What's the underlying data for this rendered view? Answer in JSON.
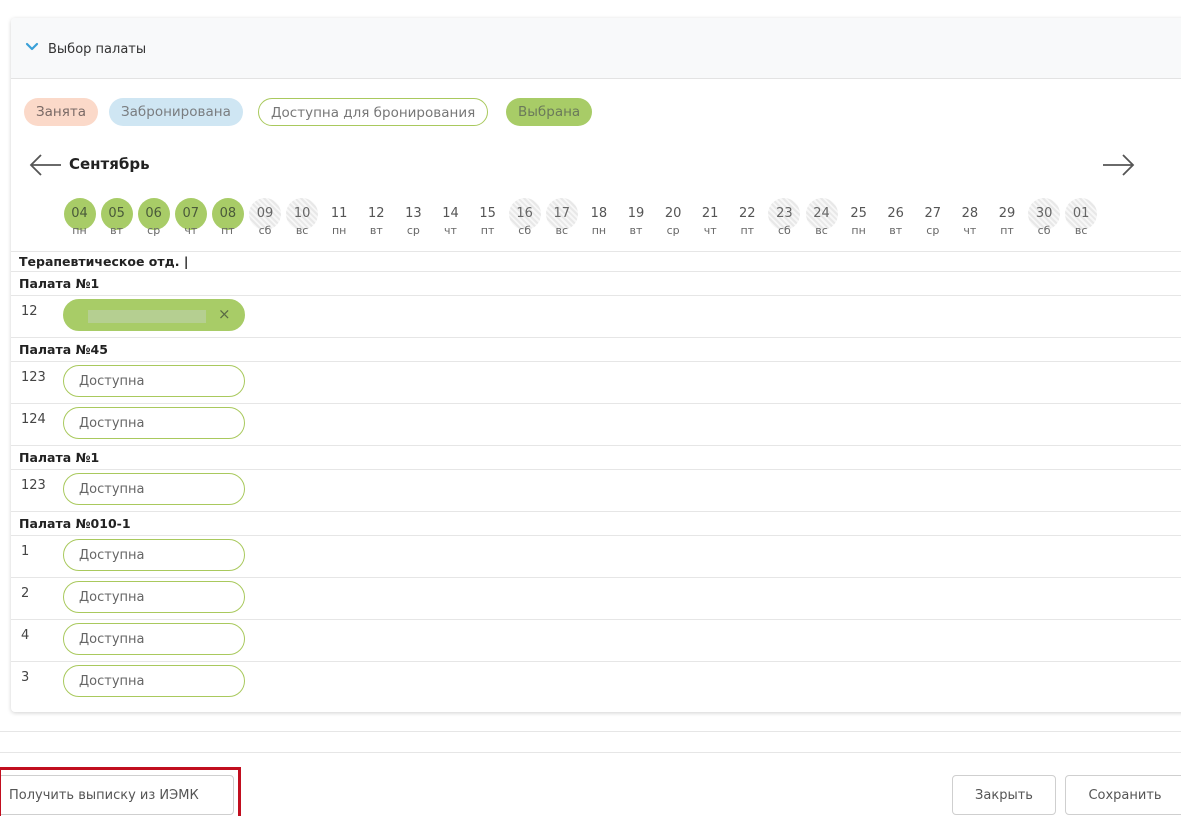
{
  "panel": {
    "title": "Выбор палаты",
    "chevron_icon": "chevron-down-icon"
  },
  "legend": {
    "busy": "Занята",
    "booked": "Забронирована",
    "available": "Доступна для бронирования",
    "selected": "Выбрана"
  },
  "calendar": {
    "month": "Сентябрь",
    "prev_icon": "arrow-left-icon",
    "next_icon": "arrow-right-icon",
    "days": [
      {
        "d": "04",
        "w": "пн",
        "s": "sel"
      },
      {
        "d": "05",
        "w": "вт",
        "s": "sel"
      },
      {
        "d": "06",
        "w": "ср",
        "s": "sel"
      },
      {
        "d": "07",
        "w": "чт",
        "s": "sel"
      },
      {
        "d": "08",
        "w": "пт",
        "s": "sel"
      },
      {
        "d": "09",
        "w": "сб",
        "s": "wk"
      },
      {
        "d": "10",
        "w": "вс",
        "s": "wk"
      },
      {
        "d": "11",
        "w": "пн",
        "s": ""
      },
      {
        "d": "12",
        "w": "вт",
        "s": ""
      },
      {
        "d": "13",
        "w": "ср",
        "s": ""
      },
      {
        "d": "14",
        "w": "чт",
        "s": ""
      },
      {
        "d": "15",
        "w": "пт",
        "s": ""
      },
      {
        "d": "16",
        "w": "сб",
        "s": "wk"
      },
      {
        "d": "17",
        "w": "вс",
        "s": "wk"
      },
      {
        "d": "18",
        "w": "пн",
        "s": ""
      },
      {
        "d": "19",
        "w": "вт",
        "s": ""
      },
      {
        "d": "20",
        "w": "ср",
        "s": ""
      },
      {
        "d": "21",
        "w": "чт",
        "s": ""
      },
      {
        "d": "22",
        "w": "пт",
        "s": ""
      },
      {
        "d": "23",
        "w": "сб",
        "s": "wk"
      },
      {
        "d": "24",
        "w": "вс",
        "s": "wk"
      },
      {
        "d": "25",
        "w": "пн",
        "s": ""
      },
      {
        "d": "26",
        "w": "вт",
        "s": ""
      },
      {
        "d": "27",
        "w": "ср",
        "s": ""
      },
      {
        "d": "28",
        "w": "чт",
        "s": ""
      },
      {
        "d": "29",
        "w": "пт",
        "s": ""
      },
      {
        "d": "30",
        "w": "сб",
        "s": "wk"
      },
      {
        "d": "01",
        "w": "вс",
        "s": "wk"
      }
    ]
  },
  "department": "Терапевтическое отд. |",
  "wards": [
    {
      "title": "Палата №1",
      "beds": [
        {
          "num": "12",
          "status": "occupied",
          "text": ""
        }
      ]
    },
    {
      "title": "Палата №45",
      "beds": [
        {
          "num": "123",
          "status": "available",
          "text": "Доступна"
        },
        {
          "num": "124",
          "status": "available",
          "text": "Доступна"
        }
      ]
    },
    {
      "title": "Палата №1",
      "beds": [
        {
          "num": "123",
          "status": "available",
          "text": "Доступна"
        }
      ]
    },
    {
      "title": "Палата №010-1",
      "beds": [
        {
          "num": "1",
          "status": "available",
          "text": "Доступна"
        },
        {
          "num": "2",
          "status": "available",
          "text": "Доступна"
        },
        {
          "num": "4",
          "status": "available",
          "text": "Доступна"
        },
        {
          "num": "3",
          "status": "available",
          "text": "Доступна"
        }
      ]
    }
  ],
  "footer": {
    "extract_label": "Получить выписку из ИЭМК",
    "close_label": "Закрыть",
    "save_label": "Сохранить"
  }
}
